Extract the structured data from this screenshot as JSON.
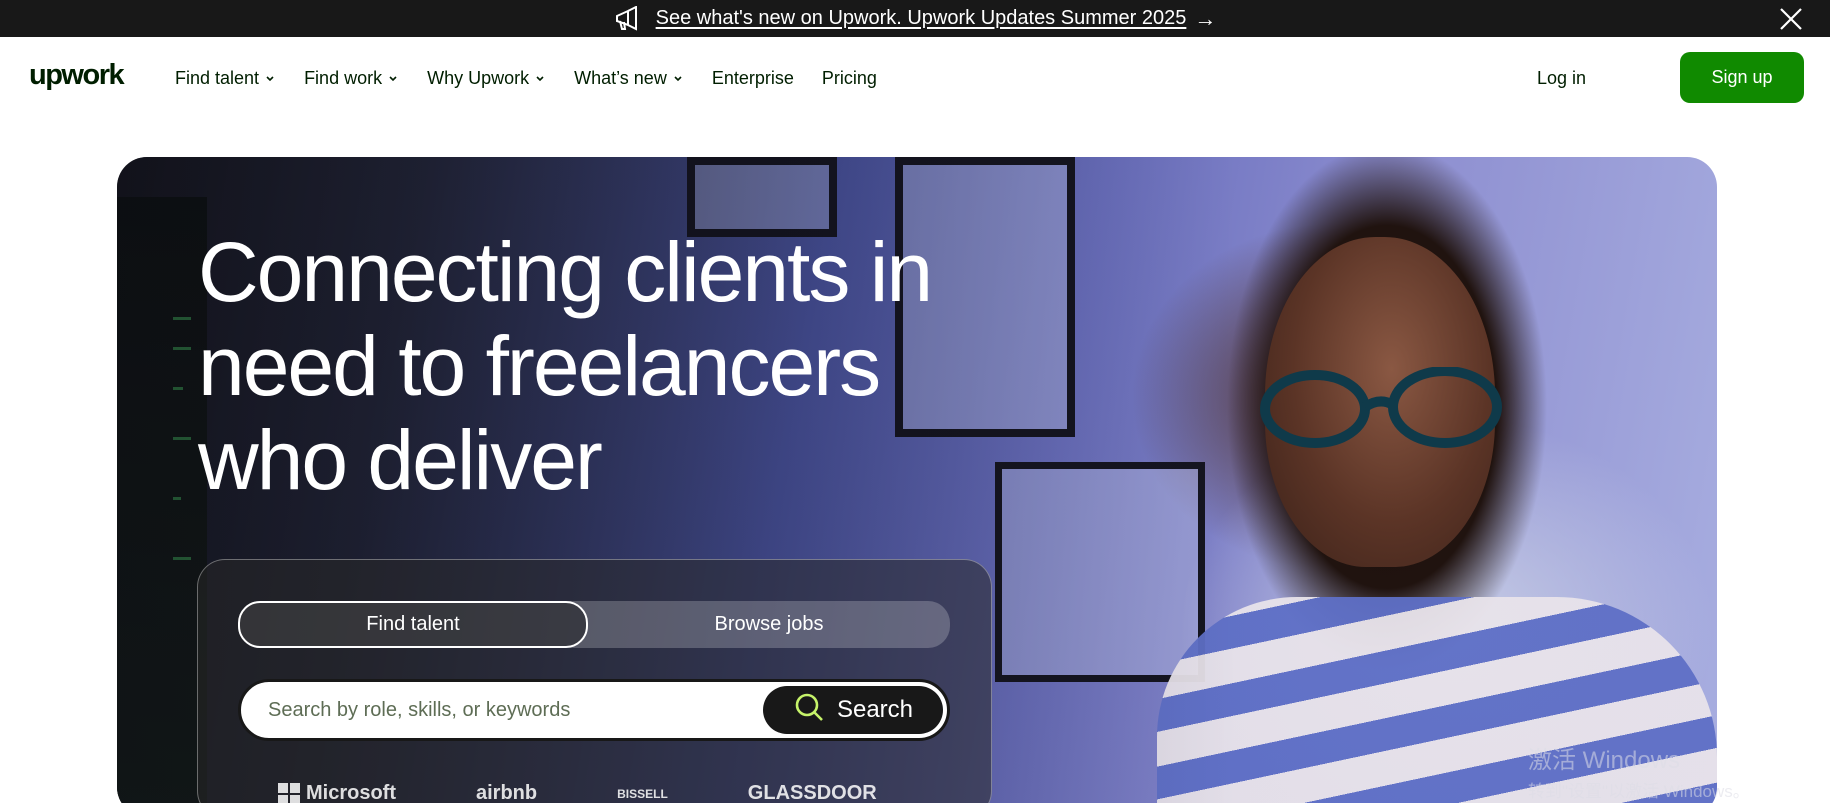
{
  "announcement": {
    "text": "See what's new on Upwork. Upwork Updates Summer 2025",
    "arrow": "→"
  },
  "nav": {
    "logo": "upwork",
    "items": [
      {
        "label": "Find talent",
        "dropdown": true
      },
      {
        "label": "Find work",
        "dropdown": true
      },
      {
        "label": "Why Upwork",
        "dropdown": true
      },
      {
        "label": "What’s new",
        "dropdown": true
      },
      {
        "label": "Enterprise",
        "dropdown": false
      },
      {
        "label": "Pricing",
        "dropdown": false
      }
    ],
    "login": "Log in",
    "signup": "Sign up"
  },
  "hero": {
    "headline_lines": [
      "Connecting clients in",
      "need to freelancers",
      "who deliver"
    ]
  },
  "search": {
    "tabs": [
      "Find talent",
      "Browse jobs"
    ],
    "active_tab": "Find talent",
    "placeholder": "Search by role, skills, or keywords",
    "value": "",
    "button_label": "Search"
  },
  "trusted_logos": [
    "Microsoft",
    "airbnb",
    "BISSELL",
    "GLASSDOOR"
  ],
  "watermark": {
    "line1": "激活 Windows",
    "line2": "转到\"设置\"以激活 Windows。"
  },
  "colors": {
    "brand_green": "#108a00",
    "announce_bg": "#181818",
    "text_dark": "#001e00"
  }
}
